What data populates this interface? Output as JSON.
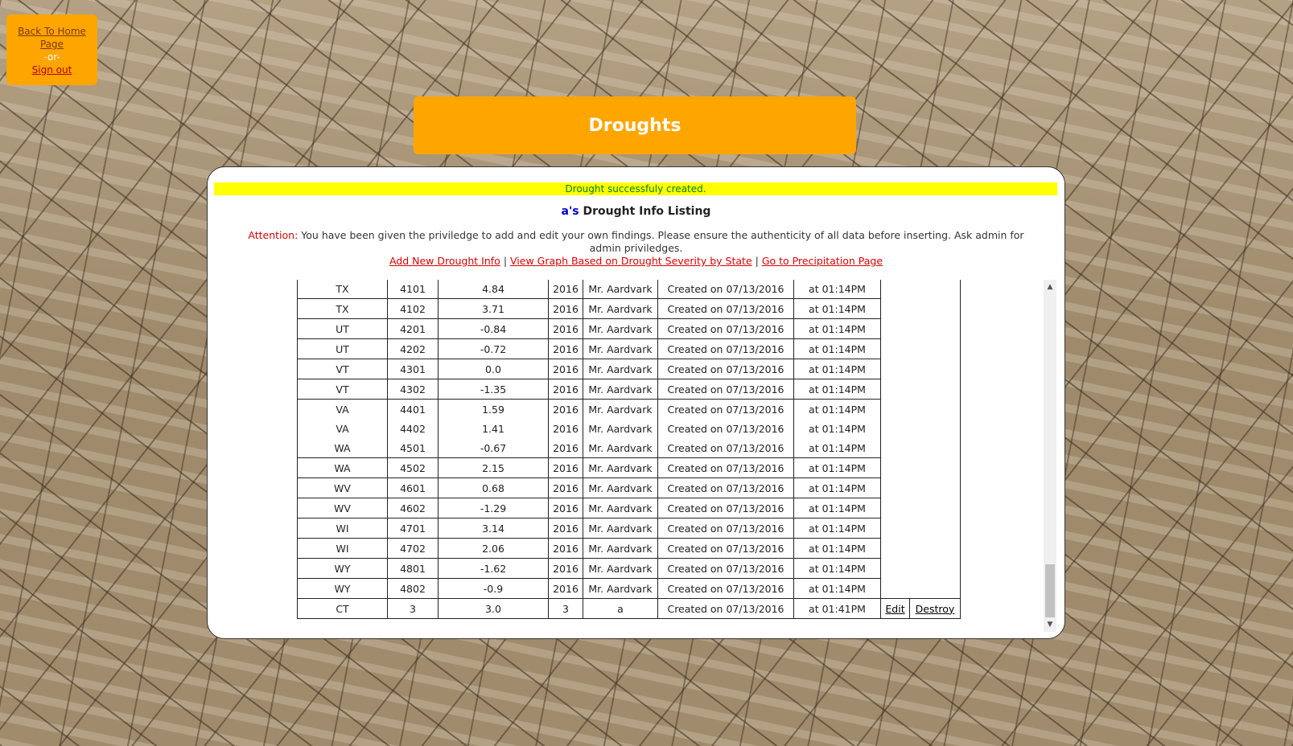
{
  "nav": {
    "home_link": "Back To Home Page",
    "or_text": "-or-",
    "signout_link": "Sign out"
  },
  "page_title": "Droughts",
  "notice": "Drought successfuly created.",
  "listing": {
    "user": "a's",
    "heading": "Drought Info Listing"
  },
  "attention": {
    "label": "Attention:",
    "text": "You have been given the priviledge to add and edit your own findings. Please ensure the authenticity of all data before inserting. Ask admin for admin priviledges."
  },
  "links": {
    "add": "Add New Drought Info",
    "graph": "View Graph Based on Drought Severity by State",
    "precip": "Go to Precipitation Page",
    "sep": "|"
  },
  "rows": [
    {
      "state": "TX",
      "code": "4101",
      "value": "4.84",
      "year": "2016",
      "author": "Mr. Aardvark",
      "created": "Created on 07/13/2016",
      "time": "at 01:14PM"
    },
    {
      "state": "TX",
      "code": "4102",
      "value": "3.71",
      "year": "2016",
      "author": "Mr. Aardvark",
      "created": "Created on 07/13/2016",
      "time": "at 01:14PM"
    },
    {
      "state": "UT",
      "code": "4201",
      "value": "-0.84",
      "year": "2016",
      "author": "Mr. Aardvark",
      "created": "Created on 07/13/2016",
      "time": "at 01:14PM"
    },
    {
      "state": "UT",
      "code": "4202",
      "value": "-0.72",
      "year": "2016",
      "author": "Mr. Aardvark",
      "created": "Created on 07/13/2016",
      "time": "at 01:14PM"
    },
    {
      "state": "VT",
      "code": "4301",
      "value": "0.0",
      "year": "2016",
      "author": "Mr. Aardvark",
      "created": "Created on 07/13/2016",
      "time": "at 01:14PM"
    },
    {
      "state": "VT",
      "code": "4302",
      "value": "-1.35",
      "year": "2016",
      "author": "Mr. Aardvark",
      "created": "Created on 07/13/2016",
      "time": "at 01:14PM"
    },
    {
      "state": "VA",
      "code": "4401",
      "value": "1.59",
      "year": "2016",
      "author": "Mr. Aardvark",
      "created": "Created on 07/13/2016",
      "time": "at 01:14PM"
    },
    {
      "state": "VA",
      "code": "4402",
      "value": "1.41",
      "year": "2016",
      "author": "Mr. Aardvark",
      "created": "Created on 07/13/2016",
      "time": "at 01:14PM"
    },
    {
      "state": "WA",
      "code": "4501",
      "value": "-0.67",
      "year": "2016",
      "author": "Mr. Aardvark",
      "created": "Created on 07/13/2016",
      "time": "at 01:14PM"
    },
    {
      "state": "WA",
      "code": "4502",
      "value": "2.15",
      "year": "2016",
      "author": "Mr. Aardvark",
      "created": "Created on 07/13/2016",
      "time": "at 01:14PM"
    },
    {
      "state": "WV",
      "code": "4601",
      "value": "0.68",
      "year": "2016",
      "author": "Mr. Aardvark",
      "created": "Created on 07/13/2016",
      "time": "at 01:14PM"
    },
    {
      "state": "WV",
      "code": "4602",
      "value": "-1.29",
      "year": "2016",
      "author": "Mr. Aardvark",
      "created": "Created on 07/13/2016",
      "time": "at 01:14PM"
    },
    {
      "state": "WI",
      "code": "4701",
      "value": "3.14",
      "year": "2016",
      "author": "Mr. Aardvark",
      "created": "Created on 07/13/2016",
      "time": "at 01:14PM"
    },
    {
      "state": "WI",
      "code": "4702",
      "value": "2.06",
      "year": "2016",
      "author": "Mr. Aardvark",
      "created": "Created on 07/13/2016",
      "time": "at 01:14PM"
    },
    {
      "state": "WY",
      "code": "4801",
      "value": "-1.62",
      "year": "2016",
      "author": "Mr. Aardvark",
      "created": "Created on 07/13/2016",
      "time": "at 01:14PM"
    },
    {
      "state": "WY",
      "code": "4802",
      "value": "-0.9",
      "year": "2016",
      "author": "Mr. Aardvark",
      "created": "Created on 07/13/2016",
      "time": "at 01:14PM"
    },
    {
      "state": "CT",
      "code": "3",
      "value": "3.0",
      "year": "3",
      "author": "a",
      "created": "Created on 07/13/2016",
      "time": "at 01:41PM",
      "edit": "Edit",
      "destroy": "Destroy"
    }
  ],
  "scrollbar": {
    "up_icon": "chevron-up",
    "down_icon": "chevron-down"
  }
}
